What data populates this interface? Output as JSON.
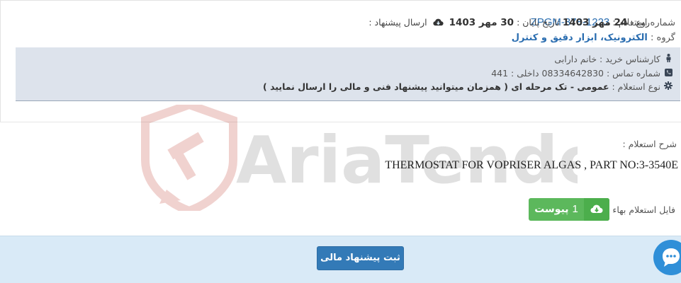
{
  "inquiry": {
    "number_label": "شماره استعلام :",
    "number": "ZPGM-378-1223",
    "group_label": "گروه :",
    "group": "الکترونیک، ابزار دقیق و کنترل"
  },
  "info": {
    "expert": "کارشناس خرید : خانم دارابی",
    "phone": "شماره تماس : 08334642830 داخلی : 441",
    "type_label": "نوع استعلام :",
    "type_value": "عمومی - تک مرحله ای ( همزمان میتوانید پیشنهاد فنی و مالی را ارسال نمایید )",
    "icons": [
      "person-icon",
      "phone-icon",
      "gear-icon"
    ]
  },
  "watermark": "AriaTender.neT",
  "description": {
    "label": "شرح استعلام :",
    "text": "THERMOSTAT FOR VOPRISER ALGAS , PART NO:3-3540E"
  },
  "file": {
    "label": "فایل استعلام بهاء :",
    "count": "1",
    "attach_label": "پیوست"
  },
  "dates": {
    "start_label": "روع :",
    "start_date": "24 مهر 1403",
    "end_label": "تاریخ پایان :",
    "end_date": "30 مهر 1403",
    "send_label": "ارسال پیشنهاد :"
  },
  "submit_label": "ثبت پیشنهاد مالی",
  "colors": {
    "accent_blue": "#2a6db0",
    "green": "#5cb85c",
    "primary": "#337ab7",
    "info_bg": "#dde3ec",
    "bottom_bg": "#d9eaf7",
    "watermark_red": "#c0392b",
    "chat_blue": "#2f8fd8"
  }
}
